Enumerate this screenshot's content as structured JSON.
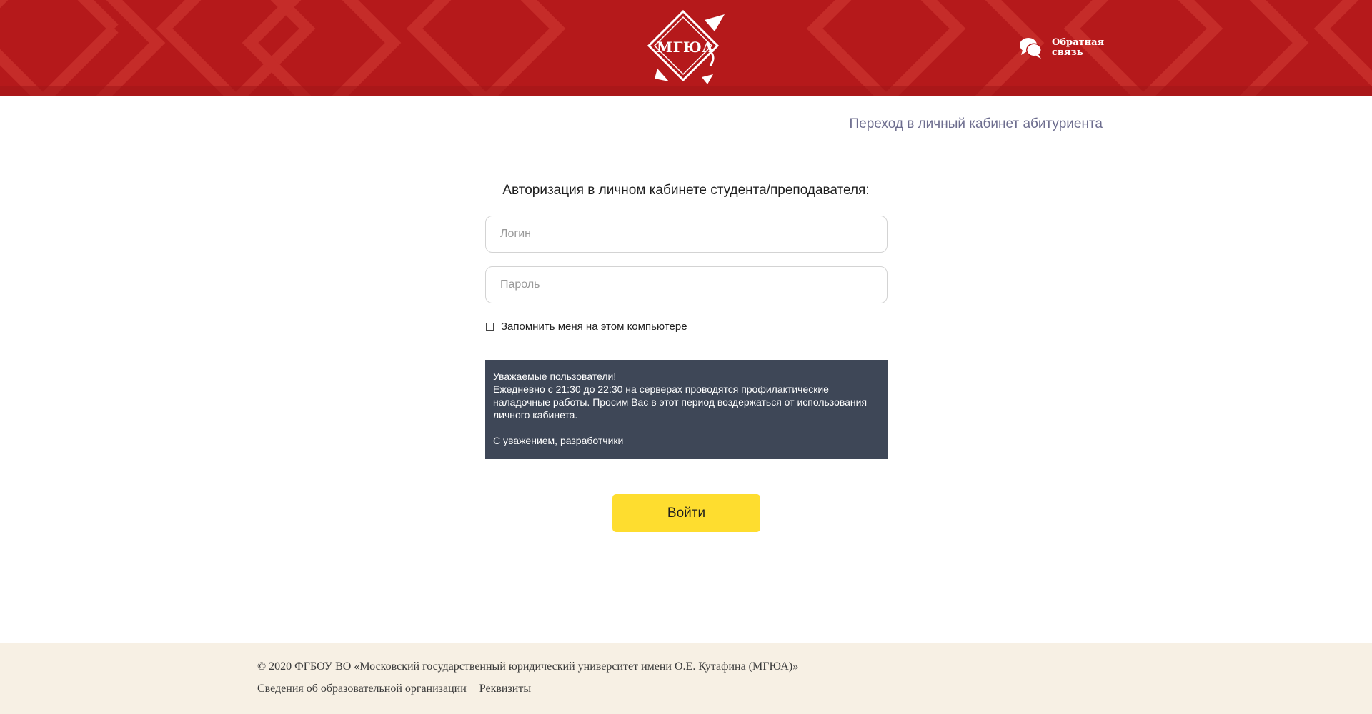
{
  "header": {
    "logo_text": "МГЮА",
    "logo_icon": "mgua-diamond-logo",
    "feedback_label": "Обратная связь",
    "feedback_icon": "chat-bubbles-icon",
    "background_color": "#b5191b"
  },
  "applicant_link": "Переход в личный кабинет абитуриента",
  "form": {
    "title": "Авторизация в личном кабинете студента/преподавателя:",
    "login_placeholder": "Логин",
    "password_placeholder": "Пароль",
    "remember_label": "Запомнить меня на этом компьютере",
    "submit_label": "Войти",
    "submit_color": "#fedd2f"
  },
  "notice": {
    "greeting": "Уважаемые пользователи!",
    "body": "Ежедневно с 21:30 до 22:30 на серверах проводятся профилактические наладочные работы. Просим Вас в этот период воздержаться от использования личного кабинета.",
    "signature": "С уважением, разработчики",
    "background_color": "#3e4757"
  },
  "footer": {
    "copyright": "© 2020 ФГБОУ ВО «Московский государственный юридический университет имени О.Е. Кутафина (МГЮА)»",
    "links": [
      "Сведения об образовательной организации",
      "Реквизиты"
    ]
  }
}
